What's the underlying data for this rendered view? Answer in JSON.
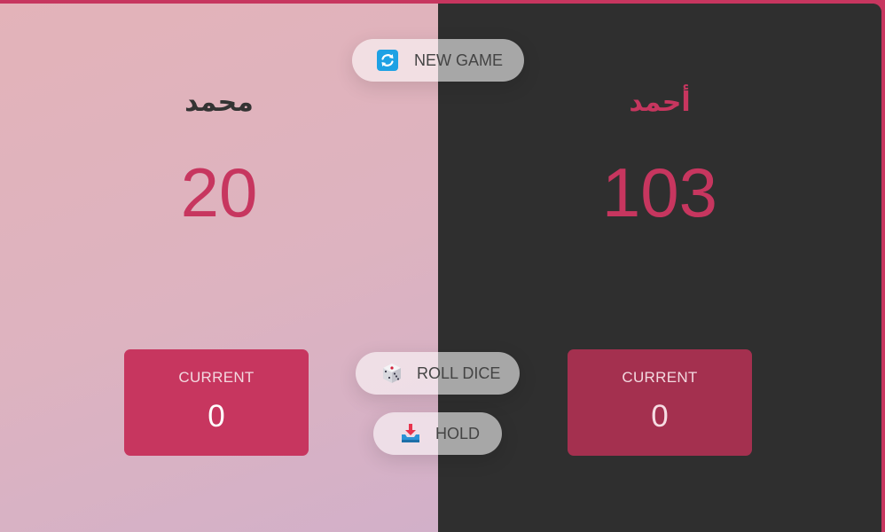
{
  "players": [
    {
      "name": "محمد",
      "score": "20",
      "current_label": "CURRENT",
      "current_score": "0",
      "active": true
    },
    {
      "name": "أحمد",
      "score": "103",
      "current_label": "CURRENT",
      "current_score": "0",
      "active": false
    }
  ],
  "buttons": {
    "new_game": {
      "label": "NEW GAME",
      "icon": "refresh-icon"
    },
    "roll_dice": {
      "label": "ROLL DICE",
      "icon": "dice-icon"
    },
    "hold": {
      "label": "HOLD",
      "icon": "inbox-tray-icon"
    }
  },
  "colors": {
    "accent": "#c7365f",
    "dark_panel": "#2f2f2f",
    "current_box_active": "#c7365f",
    "current_box_inactive": "#a4304f"
  }
}
